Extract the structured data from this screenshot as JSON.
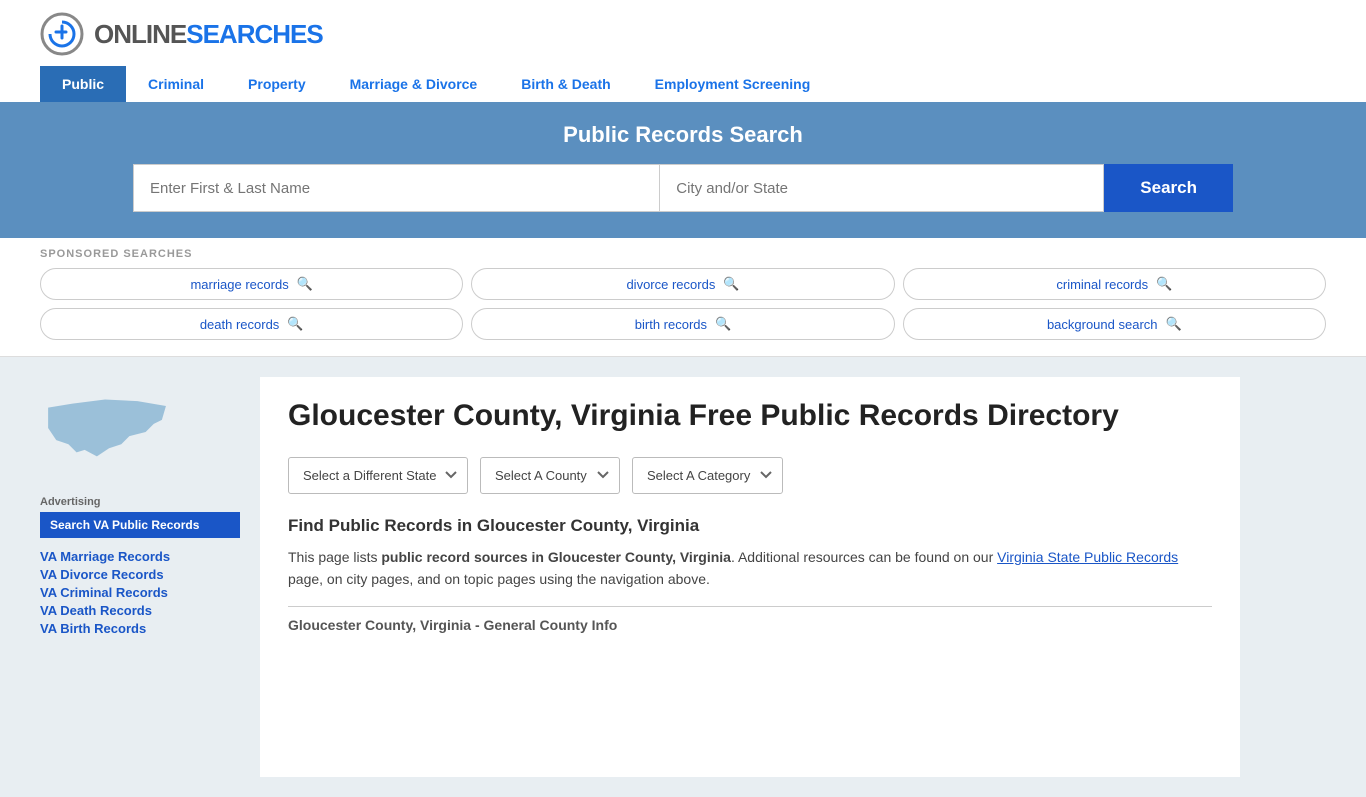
{
  "logo": {
    "text_online": "ONLINE",
    "text_searches": "SEARCHES"
  },
  "nav": {
    "items": [
      {
        "label": "Public",
        "active": true
      },
      {
        "label": "Criminal",
        "active": false
      },
      {
        "label": "Property",
        "active": false
      },
      {
        "label": "Marriage & Divorce",
        "active": false
      },
      {
        "label": "Birth & Death",
        "active": false
      },
      {
        "label": "Employment Screening",
        "active": false
      }
    ]
  },
  "banner": {
    "title": "Public Records Search",
    "name_placeholder": "Enter First & Last Name",
    "location_placeholder": "City and/or State",
    "search_button": "Search"
  },
  "sponsored": {
    "label": "SPONSORED SEARCHES",
    "links": [
      {
        "label": "marriage records"
      },
      {
        "label": "divorce records"
      },
      {
        "label": "criminal records"
      },
      {
        "label": "death records"
      },
      {
        "label": "birth records"
      },
      {
        "label": "background search"
      }
    ]
  },
  "sidebar": {
    "advertising_label": "Advertising",
    "ad_button": "Search VA Public Records",
    "links": [
      {
        "label": "VA Marriage Records"
      },
      {
        "label": "VA Divorce Records"
      },
      {
        "label": "VA Criminal Records"
      },
      {
        "label": "VA Death Records"
      },
      {
        "label": "VA Birth Records"
      }
    ]
  },
  "content": {
    "page_title": "Gloucester County, Virginia Free Public Records Directory",
    "dropdowns": {
      "state": "Select a Different State",
      "county": "Select A County",
      "category": "Select A Category"
    },
    "find_records_heading": "Find Public Records in Gloucester County, Virginia",
    "description_part1": "This page lists ",
    "description_bold1": "public record sources in Gloucester County, Virginia",
    "description_part2": ". Additional resources can be found on our ",
    "description_link": "Virginia State Public Records",
    "description_part3": " page, on city pages, and on topic pages using the navigation above.",
    "county_info_label": "Gloucester County, Virginia - General County Info"
  }
}
